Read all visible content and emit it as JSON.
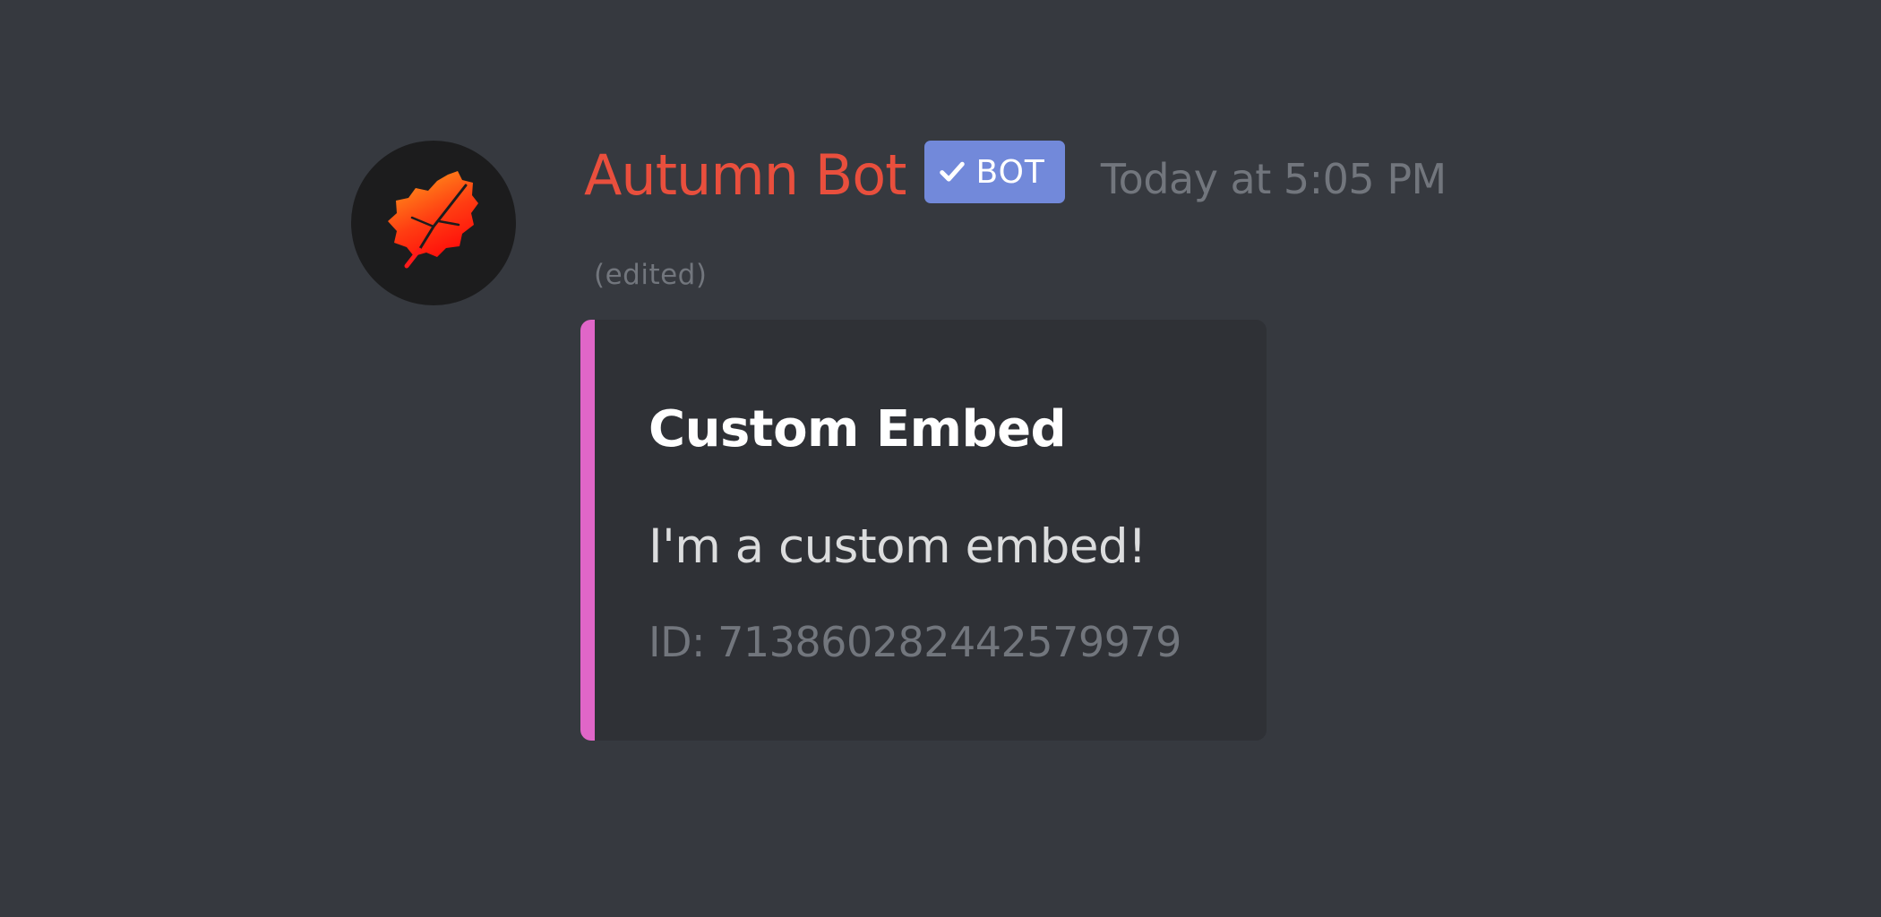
{
  "message": {
    "author": {
      "name": "Autumn Bot",
      "color": "#e94f3d",
      "avatar_icon": "maple-leaf-icon"
    },
    "bot_tag": {
      "label": "BOT",
      "verified_icon": "checkmark-icon",
      "color": "#7289da"
    },
    "timestamp": "Today at 5:05 PM",
    "edited_label": "(edited)",
    "embed": {
      "accent_color": "#e066c8",
      "title": "Custom Embed",
      "description": "I'm a custom embed!",
      "footer": "ID: 713860282442579979"
    }
  }
}
